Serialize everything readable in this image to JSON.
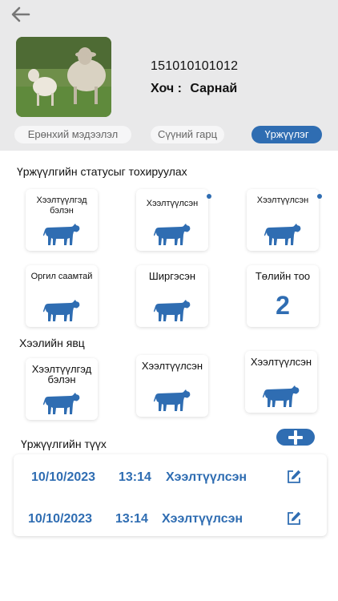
{
  "header": {
    "animal_id": "151010101012",
    "nickname_label": "Хоч",
    "nickname_sep": ":",
    "nickname_value": "Сарнай",
    "photo_icon": "sheep-photo"
  },
  "tabs": [
    {
      "label": "Ерөнхий мэдээлэл",
      "active": false
    },
    {
      "label": "Сүүний гарц",
      "active": false
    },
    {
      "label": "Үржүүлэг",
      "active": true
    }
  ],
  "status_section": {
    "title": "Үржүүлгийн статусыг тохируулах",
    "cards": [
      {
        "label": "Хээлтүүлгэд бэлэн",
        "icon": "cow-icon",
        "dot": false
      },
      {
        "label": "Хээлтүүлсэн",
        "icon": "cow-icon",
        "dot": true
      },
      {
        "label": "Хээлтүүлсэн",
        "icon": "cow-icon",
        "dot": true
      },
      {
        "label": "Оргил саамтай",
        "icon": "cow-icon",
        "dot": false
      },
      {
        "label": "Ширгэсэн",
        "icon": "cow-icon",
        "dot": false
      },
      {
        "label": "Төлийн тоо",
        "count": "2"
      }
    ]
  },
  "progress_section": {
    "title": "Хээлийн явц",
    "cards": [
      {
        "label": "Хээлтүүлгэд бэлэн",
        "icon": "cow-icon"
      },
      {
        "label": "Хээлтүүлсэн",
        "icon": "cow-icon"
      },
      {
        "label": "Хээлтүүлсэн",
        "icon": "cow-icon"
      }
    ]
  },
  "history_section": {
    "title": "Үржүүлгийн түүх",
    "add_icon": "plus-icon",
    "rows": [
      {
        "date": "10/10/2023",
        "time": "13:14",
        "status": "Хээлтүүлсэн",
        "icon": "edit-icon"
      },
      {
        "date": "10/10/2023",
        "time": "13:14",
        "status": "Хээлтүүлсэн",
        "icon": "edit-icon"
      }
    ]
  },
  "colors": {
    "accent": "#2f6db2",
    "header_bg": "#e9e9ea"
  }
}
